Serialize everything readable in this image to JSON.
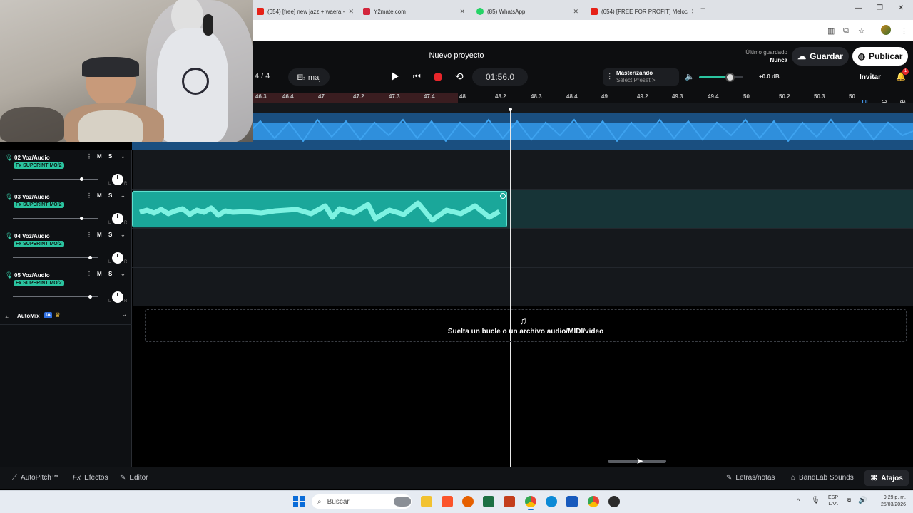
{
  "browser": {
    "tabs": [
      {
        "title": "(654) [free] new jazz + waera -",
        "color": "#e62117"
      },
      {
        "title": "Y2mate.com",
        "color": "#d3263c"
      },
      {
        "title": "(85) WhatsApp",
        "color": "#25d366"
      },
      {
        "title": "(654) [FREE FOR PROFIT] Meloc",
        "color": "#e62117"
      }
    ],
    "new_tab": "+",
    "minimize": "—",
    "maximize": "❐",
    "close": "✕"
  },
  "project": {
    "title": "Nuevo proyecto",
    "time_signature": "4 / 4",
    "key": "E♭ maj",
    "time": "01:56.0",
    "mastering_label": "Masterizando",
    "preset_label": "Select Preset >",
    "volume_db": "+0.0 dB",
    "volume_level": 0.7,
    "last_saved_label": "Último guardado",
    "last_saved_value": "Nunca",
    "save_label": "Guardar",
    "publish_label": "Publicar",
    "invite_label": "Invitar",
    "notification_count": "1"
  },
  "ruler": [
    "46.3",
    "46.4",
    "47",
    "47.2",
    "47.3",
    "47.4",
    "48",
    "48.2",
    "48.3",
    "48.4",
    "49",
    "49.2",
    "49.3",
    "49.4",
    "50",
    "50.2",
    "50.3",
    "50"
  ],
  "tracks": [
    {
      "name": "02 Voz/Audio",
      "fx": "Fx SUPERINTIMO/2",
      "mute": "M",
      "solo": "S",
      "volume": 0.8
    },
    {
      "name": "03 Voz/Audio",
      "fx": "Fx SUPERINTIMO/2",
      "mute": "M",
      "solo": "S",
      "volume": 0.8
    },
    {
      "name": "04 Voz/Audio",
      "fx": "Fx SUPERINTIMO/2",
      "mute": "M",
      "solo": "S",
      "volume": 0.9
    },
    {
      "name": "05 Voz/Audio",
      "fx": "Fx SUPERINTIMO/2",
      "mute": "M",
      "solo": "S",
      "volume": 0.9
    }
  ],
  "knob_labels": {
    "left": "L",
    "right": "R"
  },
  "automix": {
    "label": "AutoMix",
    "badge": "IA"
  },
  "dropzone_text": "Suelta un bucle o un archivo audio/MIDI/video",
  "bottom": {
    "autopitch": "AutoPitch™",
    "effects": "Efectos",
    "editor": "Editor",
    "lyrics": "Letras/notas",
    "sounds": "BandLab Sounds",
    "shortcuts": "Atajos"
  },
  "taskbar": {
    "search": "Buscar",
    "lang1": "ESP",
    "lang2": "LAA",
    "time": "9:29 p. m.",
    "date": "25/03/2026"
  },
  "colors": {
    "accent": "#2bc4a0",
    "waveform_blue": "#2f8fdc",
    "record": "#e8262b"
  }
}
